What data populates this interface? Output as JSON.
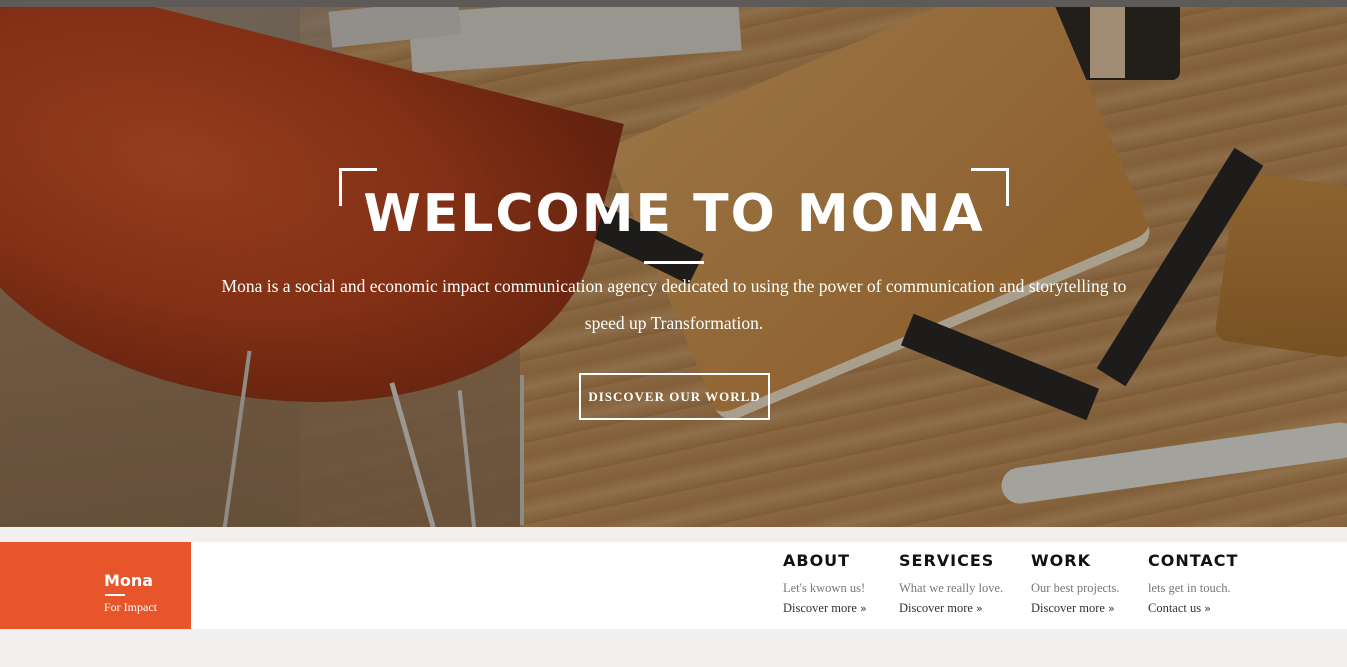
{
  "hero": {
    "title": "WELCOME TO MONA",
    "description": "Mona is a social and economic impact communication agency dedicated to using the power of communication and storytelling to speed up Transformation.",
    "button_label": "DISCOVER OUR WORLD"
  },
  "brand": {
    "name": "Mona",
    "tagline": "For Impact",
    "color": "#e8552a"
  },
  "nav": [
    {
      "title": "ABOUT",
      "subtitle": "Let's kwown us!",
      "link": "Discover more"
    },
    {
      "title": "SERVICES",
      "subtitle": "What we really love.",
      "link": "Discover more"
    },
    {
      "title": "WORK",
      "subtitle": "Our best projects.",
      "link": "Discover more"
    },
    {
      "title": "CONTACT",
      "subtitle": "lets get in touch.",
      "link": "Contact us"
    }
  ],
  "icons": {
    "link_chevron": "double-chevron-right-icon",
    "link_chevron_glyph": "»"
  }
}
